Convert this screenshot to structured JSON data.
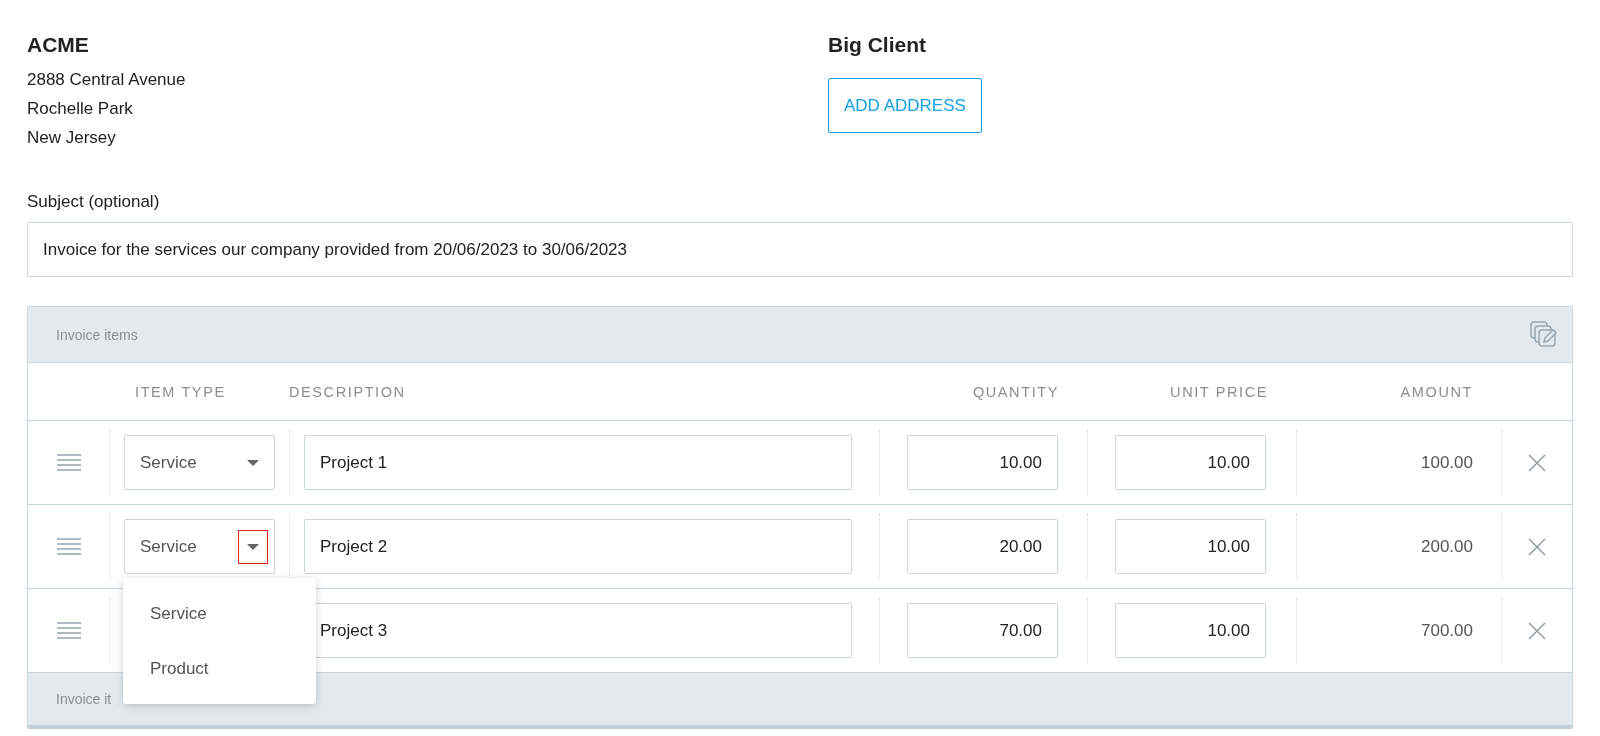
{
  "seller": {
    "name": "ACME",
    "address_lines": [
      "2888 Central Avenue",
      "Rochelle Park",
      "New Jersey"
    ]
  },
  "client": {
    "name": "Big Client",
    "add_address_button": "ADD ADDRESS"
  },
  "subject": {
    "label": "Subject (optional)",
    "value": "Invoice for the services our company provided from 20/06/2023 to 30/06/2023"
  },
  "invoice_items": {
    "title": "Invoice items",
    "columns": [
      "ITEM TYPE",
      "DESCRIPTION",
      "QUANTITY",
      "UNIT PRICE",
      "AMOUNT"
    ],
    "rows": [
      {
        "item_type": "Service",
        "caret_highlighted": false,
        "description": "Project 1",
        "quantity": "10.00",
        "unit_price": "10.00",
        "amount": "100.00"
      },
      {
        "item_type": "Service",
        "dropdown_open": true,
        "caret_highlighted": true,
        "options": [
          "Service",
          "Product"
        ],
        "description": "Project 2",
        "quantity": "20.00",
        "unit_price": "10.00",
        "amount": "200.00"
      },
      {
        "description": "Project 3",
        "quantity": "70.00",
        "unit_price": "10.00",
        "amount": "700.00"
      }
    ],
    "footer_title": "Invoice it"
  }
}
